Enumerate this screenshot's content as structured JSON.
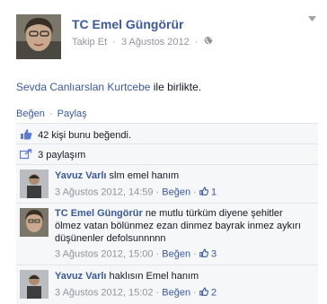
{
  "post": {
    "author": "TC Emel Güngörür",
    "follow_label": "Takip Et",
    "date": "3 Ağustos 2012",
    "text_name": "Sevda Canlıarslan Kurtcebe",
    "text_suffix": "ile birlikte."
  },
  "actions": {
    "like": "Beğen",
    "share": "Paylaş",
    "sep": "·"
  },
  "likes": {
    "text": "42 kişi bunu beğendi."
  },
  "shares": {
    "text": "3 paylaşım"
  },
  "comments": [
    {
      "author": "Yavuz Varlı",
      "text": "slm emel hanım",
      "date": "3 Ağustos 2012, 14:59",
      "like_label": "Beğen",
      "likes": "1"
    },
    {
      "author": "TC Emel Güngörür",
      "text": "ne mutlu türküm diyene şehitler ölmez vatan bölünmez ezan dinmez bayrak inmez aykırı düşünenler defolsunnnnn",
      "date": "3 Ağustos 2012, 15:00",
      "like_label": "Beğen",
      "likes": "3"
    },
    {
      "author": "Yavuz Varlı",
      "text": "haklısın Emel hanım",
      "date": "3 Ağustos 2012, 15:02",
      "like_label": "Beğen",
      "likes": "2"
    }
  ],
  "colors": {
    "link": "#3b5998",
    "panel": "#f6f7f9",
    "meta": "#90949c"
  }
}
